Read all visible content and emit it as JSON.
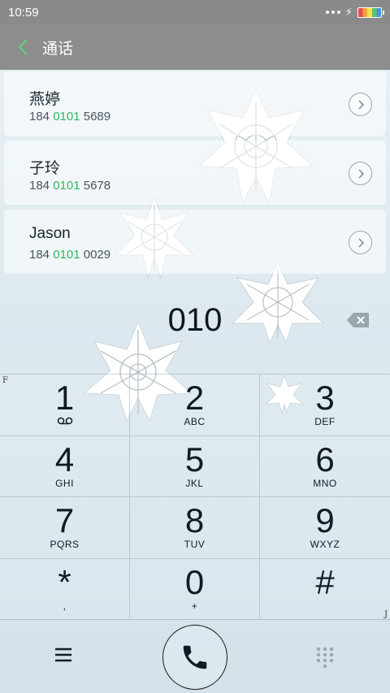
{
  "status": {
    "time": "10:59"
  },
  "header": {
    "title": "通话"
  },
  "contacts": [
    {
      "name": "燕婷",
      "num_pre": "184 ",
      "num_hl": "0101",
      "num_post": " 5689"
    },
    {
      "name": "子玲",
      "num_pre": "184 ",
      "num_hl": "0101",
      "num_post": " 5678"
    },
    {
      "name": "Jason",
      "num_pre": "184 ",
      "num_hl": "0101",
      "num_post": " 0029"
    }
  ],
  "dial": {
    "entered": "010"
  },
  "keys": [
    {
      "digit": "1",
      "letters": ""
    },
    {
      "digit": "2",
      "letters": "ABC"
    },
    {
      "digit": "3",
      "letters": "DEF"
    },
    {
      "digit": "4",
      "letters": "GHI"
    },
    {
      "digit": "5",
      "letters": "JKL"
    },
    {
      "digit": "6",
      "letters": "MNO"
    },
    {
      "digit": "7",
      "letters": "PQRS"
    },
    {
      "digit": "8",
      "letters": "TUV"
    },
    {
      "digit": "9",
      "letters": "WXYZ"
    },
    {
      "digit": "*",
      "letters": ","
    },
    {
      "digit": "0",
      "letters": "+"
    },
    {
      "digit": "#",
      "letters": ""
    }
  ],
  "corner_marks": {
    "left": "F",
    "right": "J"
  },
  "icons": {
    "back": "chevron-left-icon",
    "backspace": "backspace-icon",
    "voicemail": "voicemail-icon",
    "menu": "menu-icon",
    "call": "phone-icon",
    "dialpad": "dialpad-icon"
  },
  "colors": {
    "highlight": "#2eb85c",
    "header": "#8d8d8d",
    "back_arrow": "#5fd07a"
  }
}
